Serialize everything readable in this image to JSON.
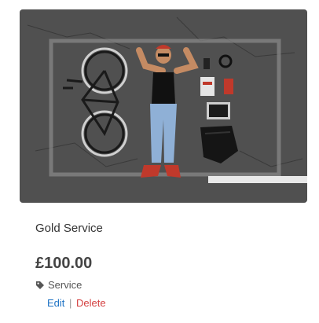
{
  "product": {
    "title": "Gold Service",
    "price": "£100.00",
    "category": "Service",
    "image_alt": "product-photo"
  },
  "actions": {
    "edit_label": "Edit",
    "separator": "|",
    "delete_label": "Delete"
  },
  "colors": {
    "edit_link": "#1f73c4",
    "delete_link": "#d43f3f",
    "title_text": "#333333",
    "price_text": "#444444"
  },
  "icons": {
    "category": "tag-icon"
  }
}
